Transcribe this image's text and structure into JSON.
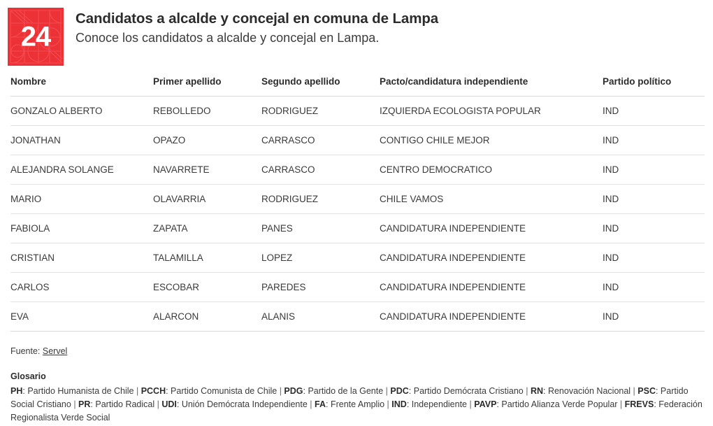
{
  "header": {
    "logo": {
      "text": "24",
      "brand_color": "#ED3237",
      "name": "canal-24-horas-logo"
    },
    "title": "Candidatos a alcalde y concejal en comuna de Lampa",
    "subtitle": "Conoce los candidatos a alcalde y concejal en Lampa."
  },
  "table": {
    "columns": [
      "Nombre",
      "Primer apellido",
      "Segundo apellido",
      "Pacto/candidatura independiente",
      "Partido político"
    ],
    "rows": [
      {
        "nombre": "GONZALO ALBERTO",
        "primer_apellido": "REBOLLEDO",
        "segundo_apellido": "RODRIGUEZ",
        "pacto": "IZQUIERDA ECOLOGISTA POPULAR",
        "partido": "IND"
      },
      {
        "nombre": "JONATHAN",
        "primer_apellido": "OPAZO",
        "segundo_apellido": "CARRASCO",
        "pacto": "CONTIGO CHILE MEJOR",
        "partido": "IND"
      },
      {
        "nombre": "ALEJANDRA SOLANGE",
        "primer_apellido": "NAVARRETE",
        "segundo_apellido": "CARRASCO",
        "pacto": "CENTRO DEMOCRATICO",
        "partido": "IND"
      },
      {
        "nombre": "MARIO",
        "primer_apellido": "OLAVARRIA",
        "segundo_apellido": "RODRIGUEZ",
        "pacto": "CHILE VAMOS",
        "partido": "IND"
      },
      {
        "nombre": "FABIOLA",
        "primer_apellido": "ZAPATA",
        "segundo_apellido": "PANES",
        "pacto": "CANDIDATURA INDEPENDIENTE",
        "partido": "IND"
      },
      {
        "nombre": "CRISTIAN",
        "primer_apellido": "TALAMILLA",
        "segundo_apellido": "LOPEZ",
        "pacto": "CANDIDATURA INDEPENDIENTE",
        "partido": "IND"
      },
      {
        "nombre": "CARLOS",
        "primer_apellido": "ESCOBAR",
        "segundo_apellido": "PAREDES",
        "pacto": "CANDIDATURA INDEPENDIENTE",
        "partido": "IND"
      },
      {
        "nombre": "EVA",
        "primer_apellido": "ALARCON",
        "segundo_apellido": "ALANIS",
        "pacto": "CANDIDATURA INDEPENDIENTE",
        "partido": "IND"
      }
    ]
  },
  "footer": {
    "source_label": "Fuente:",
    "source_link": "Servel",
    "glossary_title": "Glosario",
    "glossary_entries": [
      {
        "abbr": "PH",
        "definition": "Partido Humanista de Chile"
      },
      {
        "abbr": "PCCH",
        "definition": "Partido Comunista de Chile"
      },
      {
        "abbr": "PDG",
        "definition": "Partido de la Gente"
      },
      {
        "abbr": "PDC",
        "definition": "Partido Demócrata Cristiano"
      },
      {
        "abbr": "RN",
        "definition": "Renovación Nacional"
      },
      {
        "abbr": "PSC",
        "definition": "Partido Social Cristiano"
      },
      {
        "abbr": "PR",
        "definition": "Partido Radical"
      },
      {
        "abbr": "UDI",
        "definition": "Unión Demócrata Independiente"
      },
      {
        "abbr": "FA",
        "definition": "Frente Amplio"
      },
      {
        "abbr": "IND",
        "definition": "Independiente"
      },
      {
        "abbr": "PAVP",
        "definition": "Partido Alianza Verde Popular"
      },
      {
        "abbr": "FREVS",
        "definition": "Federación Regionalista Verde Social"
      }
    ],
    "glossary_separator": "|"
  }
}
